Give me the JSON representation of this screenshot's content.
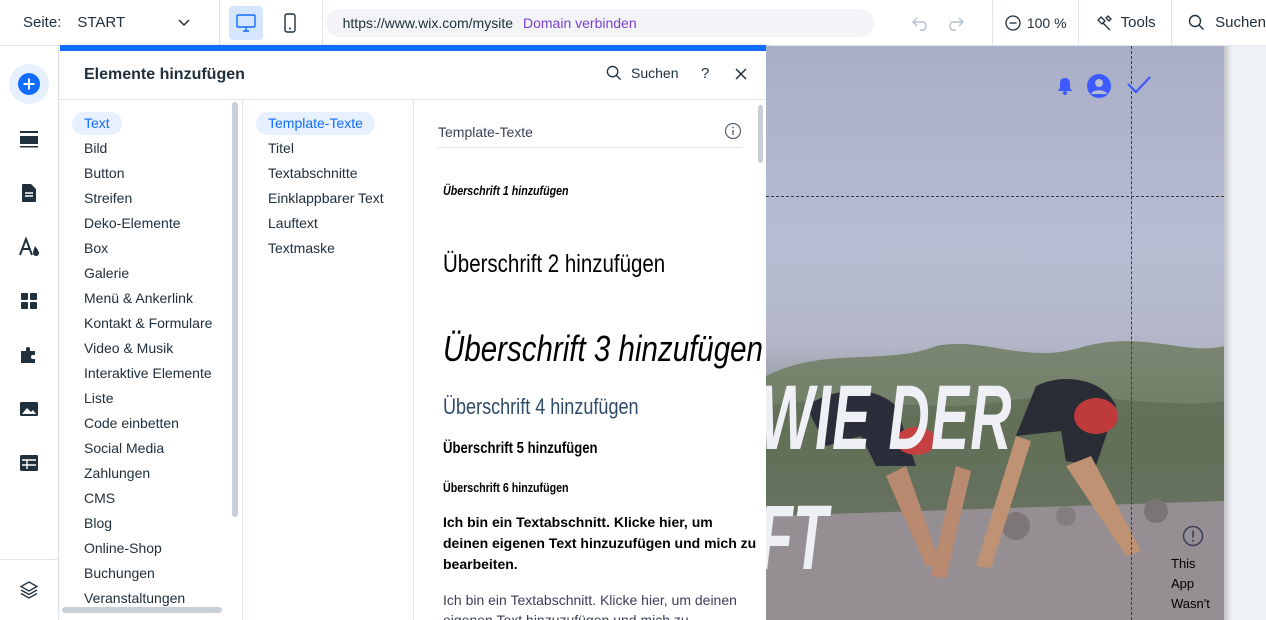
{
  "topbar": {
    "page_label": "Seite:",
    "page_value": "START",
    "url": "https://www.wix.com/mysite",
    "connect_domain": "Domain verbinden",
    "zoom": "100 %",
    "tools": "Tools",
    "search": "Suchen"
  },
  "panel": {
    "title": "Elemente hinzufügen",
    "search": "Suchen",
    "help": "?",
    "categories": [
      "Text",
      "Bild",
      "Button",
      "Streifen",
      "Deko-Elemente",
      "Box",
      "Galerie",
      "Menü & Ankerlink",
      "Kontakt & Formulare",
      "Video & Musik",
      "Interaktive Elemente",
      "Liste",
      "Code einbetten",
      "Social Media",
      "Zahlungen",
      "CMS",
      "Blog",
      "Online-Shop",
      "Buchungen",
      "Veranstaltungen"
    ],
    "subcategories": [
      "Template-Texte",
      "Titel",
      "Textabschnitte",
      "Einklappbarer Text",
      "Lauftext",
      "Textmaske"
    ],
    "section_title": "Template-Texte",
    "templates": {
      "h1": "Überschrift 1 hinzufügen",
      "h2": "Überschrift 2 hinzufügen",
      "h3": "Überschrift 3 hinzufügen",
      "h4": "Überschrift 4 hinzufügen",
      "h5": "Überschrift 5 hinzufügen",
      "h6": "Überschrift 6 hinzufügen",
      "p1": "Ich bin ein Textabschnitt. Klicke hier, um deinen eigenen Text hinzuzufügen und mich zu bearbeiten.",
      "p2": "Ich bin ein Textabschnitt. Klicke hier, um deinen eigenen Text hinzuzufügen und mich zu bearbeiten."
    }
  },
  "site": {
    "headline_1": "WIE DER",
    "headline_2": "FT",
    "warning": "This App Wasn't"
  },
  "colors": {
    "accent": "#116dff",
    "accent_bg": "#e7f0ff",
    "domain_link": "#7a3fd2",
    "site_icons": "#3d5afe"
  }
}
